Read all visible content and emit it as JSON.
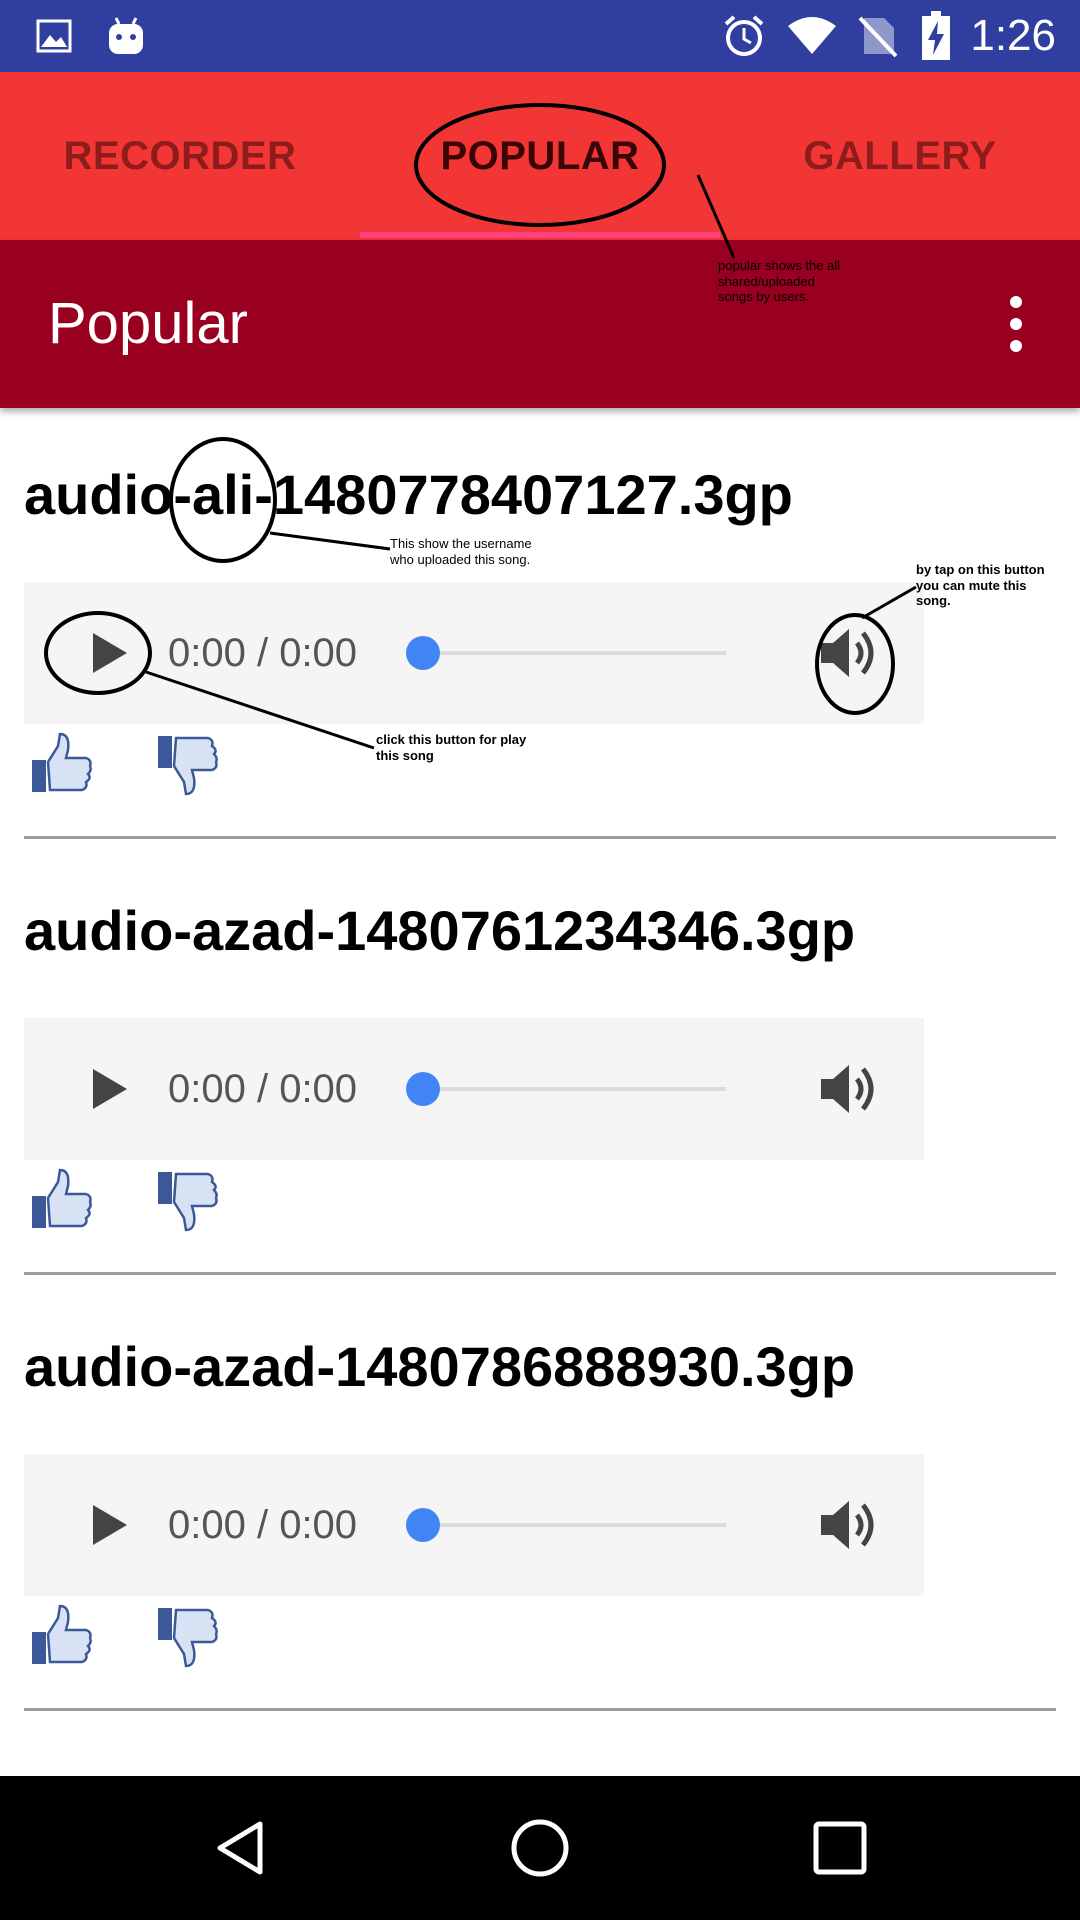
{
  "status_bar": {
    "time": "1:26",
    "left_icons": [
      "gallery-icon",
      "android-icon"
    ],
    "right_icons": [
      "alarm-icon",
      "wifi-icon",
      "no-sim-icon",
      "battery-charging-icon"
    ]
  },
  "tabs": [
    {
      "label": "RECORDER",
      "active": false
    },
    {
      "label": "POPULAR",
      "active": true
    },
    {
      "label": "GALLERY",
      "active": false
    }
  ],
  "toolbar": {
    "title": "Popular",
    "menu_icon": "more-vert-icon"
  },
  "songs": [
    {
      "title": "audio-ali-1480778407127.3gp",
      "time": "0:00 / 0:00"
    },
    {
      "title": "audio-azad-1480761234346.3gp",
      "time": "0:00 / 0:00"
    },
    {
      "title": "audio-azad-1480786888930.3gp",
      "time": "0:00 / 0:00"
    }
  ],
  "annotations": {
    "popular": "popular shows the all\nshared/uploaded\nsongs by users.",
    "username": "This show the username\nwho uploaded this song.",
    "mute": "by tap on this button\nyou can mute this\nsong.",
    "play": "click this button for play\nthis song"
  },
  "colors": {
    "status_bar": "#303f9f",
    "tab_bar": "#f23535",
    "toolbar": "#990020",
    "tab_indicator": "#ff4081",
    "seek_thumb": "#4285f4"
  },
  "nav_bar": {
    "icons": [
      "back-icon",
      "home-icon",
      "recents-icon"
    ]
  }
}
